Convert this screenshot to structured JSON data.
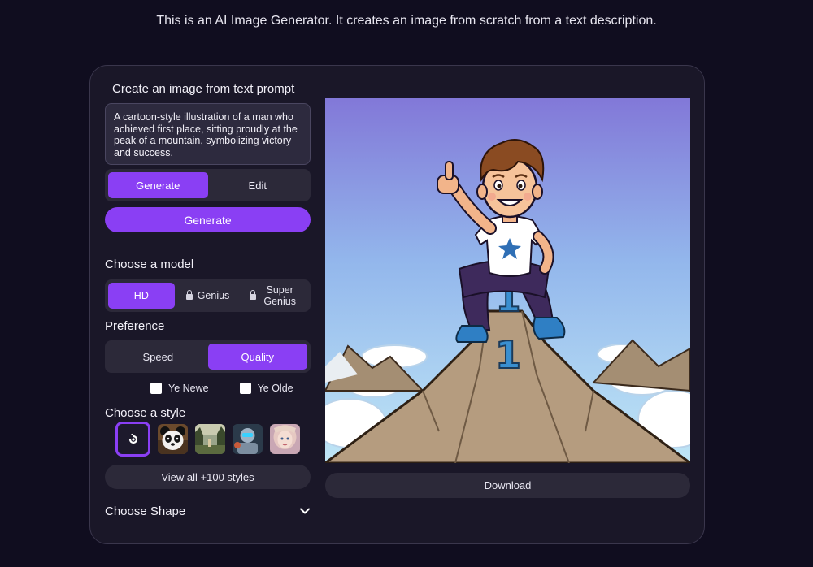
{
  "header": {
    "intro": "This is an AI Image Generator. It creates an image from scratch from a text description."
  },
  "prompt": {
    "title": "Create an image from text prompt",
    "text": "A cartoon-style illustration of a man who achieved first place, sitting proudly at the peak of a mountain, symbolizing victory and success."
  },
  "mode_tabs": [
    {
      "label": "Generate",
      "active": true
    },
    {
      "label": "Edit",
      "active": false
    }
  ],
  "generate_button": "Generate",
  "model": {
    "title": "Choose a model",
    "options": [
      {
        "label": "HD",
        "active": true,
        "locked": false
      },
      {
        "label": "Genius",
        "active": false,
        "locked": true
      },
      {
        "label": "Super Genius",
        "active": false,
        "locked": true
      }
    ]
  },
  "preference": {
    "title": "Preference",
    "options": [
      {
        "label": "Speed",
        "active": false
      },
      {
        "label": "Quality",
        "active": true
      }
    ],
    "checkboxes": [
      {
        "label": "Ye Newe",
        "checked": false
      },
      {
        "label": "Ye Olde",
        "checked": false
      }
    ]
  },
  "style": {
    "title": "Choose a style",
    "thumbnails": [
      "no-style-icon",
      "panda-style",
      "forest-style",
      "robot-style",
      "portrait-style"
    ],
    "selected": 0,
    "view_all": "View all +100 styles"
  },
  "shape": {
    "title": "Choose Shape",
    "icon": "chevron-down-icon"
  },
  "result": {
    "image_label": "1",
    "download": "Download"
  },
  "colors": {
    "accent": "#8a3ff4",
    "background": "#100d1f",
    "card": "#1a1728"
  }
}
